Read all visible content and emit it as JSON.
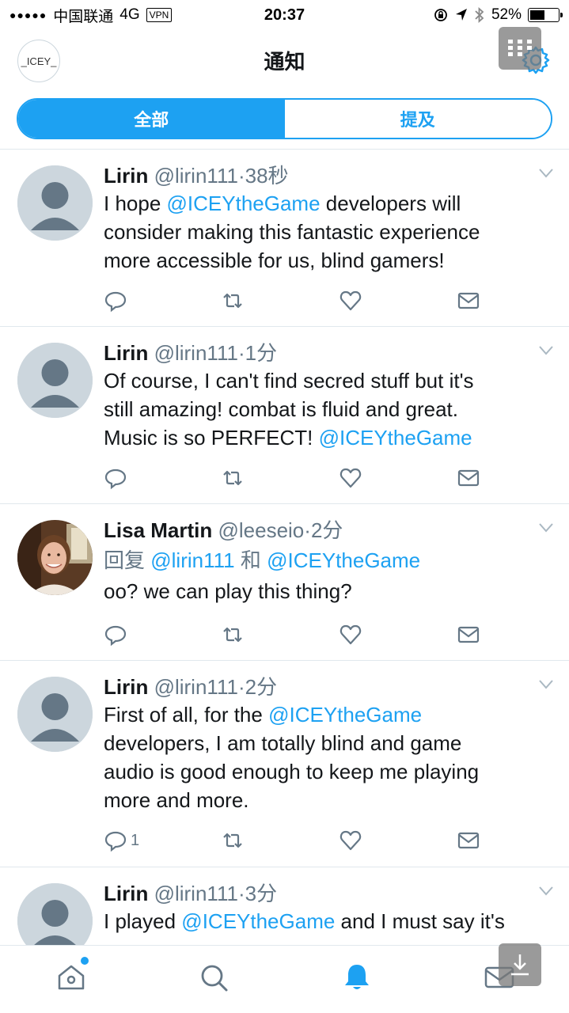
{
  "status_bar": {
    "signal": "●●●●●",
    "carrier": "中国联通",
    "network": "4G",
    "vpn": "VPN",
    "time": "20:37",
    "battery": "52%"
  },
  "nav": {
    "avatar_text": "_ICEY_",
    "title": "通知"
  },
  "segments": [
    {
      "label": "全部",
      "active": true
    },
    {
      "label": "提及",
      "active": false
    }
  ],
  "tweets": [
    {
      "name": "Lirin",
      "handle": "@lirin111",
      "dot": "·",
      "time": "38秒",
      "lines": [
        [
          {
            "t": "I hope "
          },
          {
            "m": "@ICEYtheGame"
          },
          {
            "t": " developers will"
          }
        ],
        [
          {
            "t": "consider making this fantastic experience"
          }
        ],
        [
          {
            "t": "more accessible for us, blind gamers!"
          }
        ]
      ],
      "reply_count": ""
    },
    {
      "name": "Lirin",
      "handle": "@lirin111",
      "dot": "·",
      "time": "1分",
      "lines": [
        [
          {
            "t": "Of course, I can't find secred stuff but it's"
          }
        ],
        [
          {
            "t": "still amazing! combat is fluid and great."
          }
        ],
        [
          {
            "t": "Music is so PERFECT! "
          },
          {
            "m": "@ICEYtheGame"
          }
        ]
      ],
      "reply_count": ""
    },
    {
      "name": "Lisa Martin",
      "handle": "@leeseio",
      "dot": "·",
      "time": "2分",
      "reply_to": {
        "prefix": "回复",
        "user1": "@lirin111",
        "and": "和",
        "user2": "@ICEYtheGame"
      },
      "lines": [
        [
          {
            "t": "oo? we can play this thing?"
          }
        ]
      ],
      "reply_count": ""
    },
    {
      "name": "Lirin",
      "handle": "@lirin111",
      "dot": "·",
      "time": "2分",
      "lines": [
        [
          {
            "t": "First of all, for the "
          },
          {
            "m": "@ICEYtheGame"
          }
        ],
        [
          {
            "t": "developers, I am totally blind and game"
          }
        ],
        [
          {
            "t": "audio is good enough to keep me playing"
          }
        ],
        [
          {
            "t": "more and more."
          }
        ]
      ],
      "reply_count": "1"
    },
    {
      "name": "Lirin",
      "handle": "@lirin111",
      "dot": "·",
      "time": "3分",
      "lines": [
        [
          {
            "t": "I played "
          },
          {
            "m": "@ICEYtheGame"
          },
          {
            "t": " and I must say it's"
          }
        ]
      ],
      "reply_count": ""
    }
  ],
  "tabbar": [
    "home-icon",
    "search-icon",
    "notifications-icon",
    "messages-icon"
  ],
  "colors": {
    "accent": "#1da1f2",
    "secondary_text": "#657786",
    "divider": "#e1e8ed"
  }
}
